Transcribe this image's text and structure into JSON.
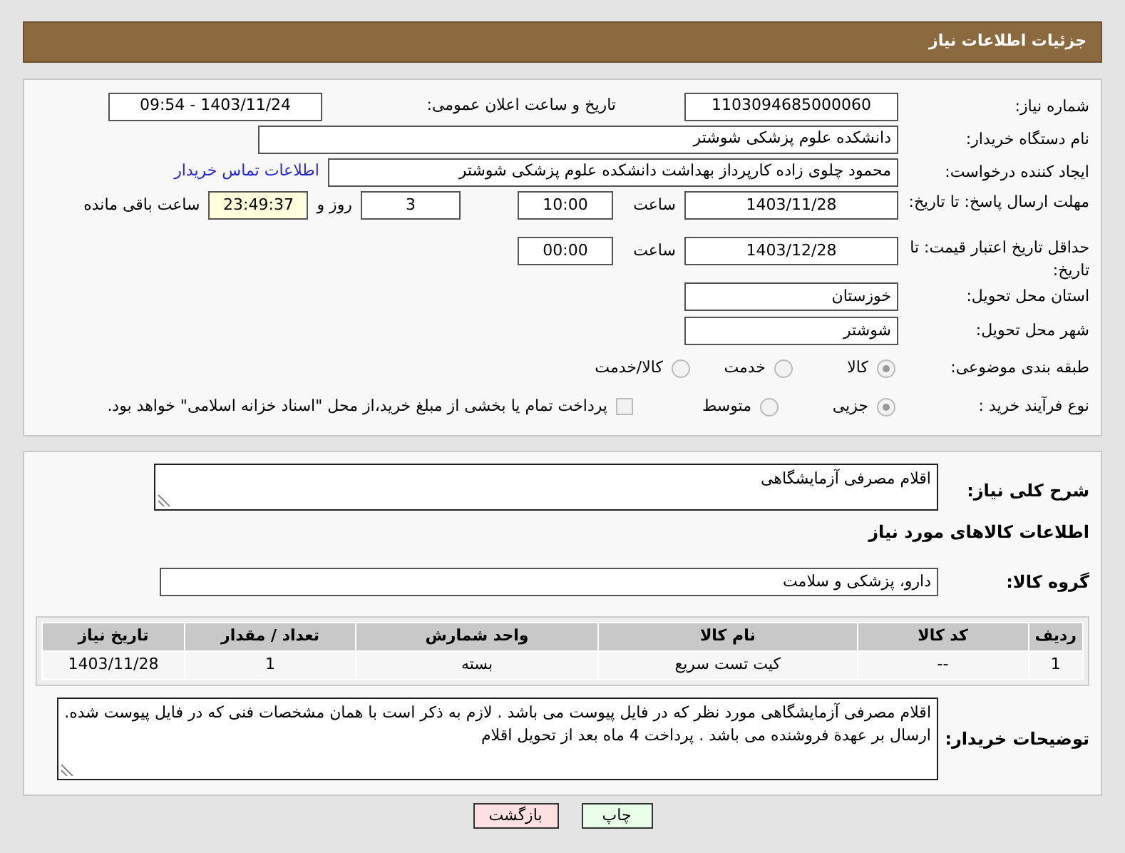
{
  "header": {
    "title": "جزئیات اطلاعات نیاز"
  },
  "details": {
    "need_number": {
      "label": "شماره نیاز:",
      "value": "1103094685000060"
    },
    "announce": {
      "label": "تاریخ و ساعت اعلان عمومی:",
      "value": "1403/11/24 - 09:54"
    },
    "buyer": {
      "label": "نام دستگاه خریدار:",
      "value": "دانشکده علوم پزشکی شوشتر"
    },
    "creator": {
      "label": "ایجاد کننده درخواست:",
      "value": "محمود چلوی زاده کارپرداز بهداشت دانشکده علوم پزشکی شوشتر",
      "link": "اطلاعات تماس خریدار"
    },
    "deadline": {
      "label": "مهلت ارسال پاسخ: تا تاریخ:",
      "date": "1403/11/28",
      "time_label": "ساعت",
      "time": "10:00",
      "days": "3",
      "days_label": "روز و",
      "remaining": "23:49:37",
      "remaining_label": "ساعت باقی مانده"
    },
    "validity": {
      "label": "حداقل تاریخ اعتبار قیمت: تا تاریخ:",
      "date": "1403/12/28",
      "time_label": "ساعت",
      "time": "00:00"
    },
    "province": {
      "label": "استان محل تحویل:",
      "value": "خوزستان"
    },
    "city": {
      "label": "شهر محل تحویل:",
      "value": "شوشتر"
    },
    "category": {
      "label": "طبقه بندی موضوعی:",
      "disabled": true,
      "options": [
        {
          "label": "کالا",
          "selected": true
        },
        {
          "label": "خدمت",
          "selected": false
        },
        {
          "label": "کالا/خدمت",
          "selected": false
        }
      ]
    },
    "process": {
      "label": "نوع فرآیند خرید :",
      "disabled": true,
      "options": [
        {
          "label": "جزیی",
          "selected": true
        },
        {
          "label": "متوسط",
          "selected": false
        }
      ],
      "payment": {
        "checked": false,
        "text": "پرداخت تمام یا بخشی از مبلغ خرید،از محل \"اسناد خزانه اسلامی\" خواهد بود."
      }
    }
  },
  "items": {
    "summary": {
      "label": "شرح کلی نیاز:",
      "value": "اقلام مصرفی آزمایشگاهی"
    },
    "section_title": "اطلاعات کالاهای مورد نیاز",
    "group": {
      "label": "گروه کالا:",
      "value": "دارو، پزشکی و سلامت"
    },
    "table": {
      "columns": [
        "ردیف",
        "کد کالا",
        "نام کالا",
        "واحد شمارش",
        "تعداد / مقدار",
        "تاریخ نیاز"
      ],
      "rows": [
        [
          "1",
          "--",
          "کیت تست سریع",
          "بسته",
          "1",
          "1403/11/28"
        ]
      ]
    },
    "notes": {
      "label": "توضیحات خریدار:",
      "value": "اقلام مصرفی آزمایشگاهی مورد نظر که در فایل پیوست می باشد . لازم به ذکر است با همان مشخصات فنی که در فایل پیوست  شده. ارسال بر عهدة فروشنده می باشد . پرداخت 4 ماه بعد از تحویل اقلام"
    }
  },
  "buttons": [
    {
      "label": "چاپ",
      "kind": "print"
    },
    {
      "label": "بازگشت",
      "kind": "back"
    }
  ]
}
